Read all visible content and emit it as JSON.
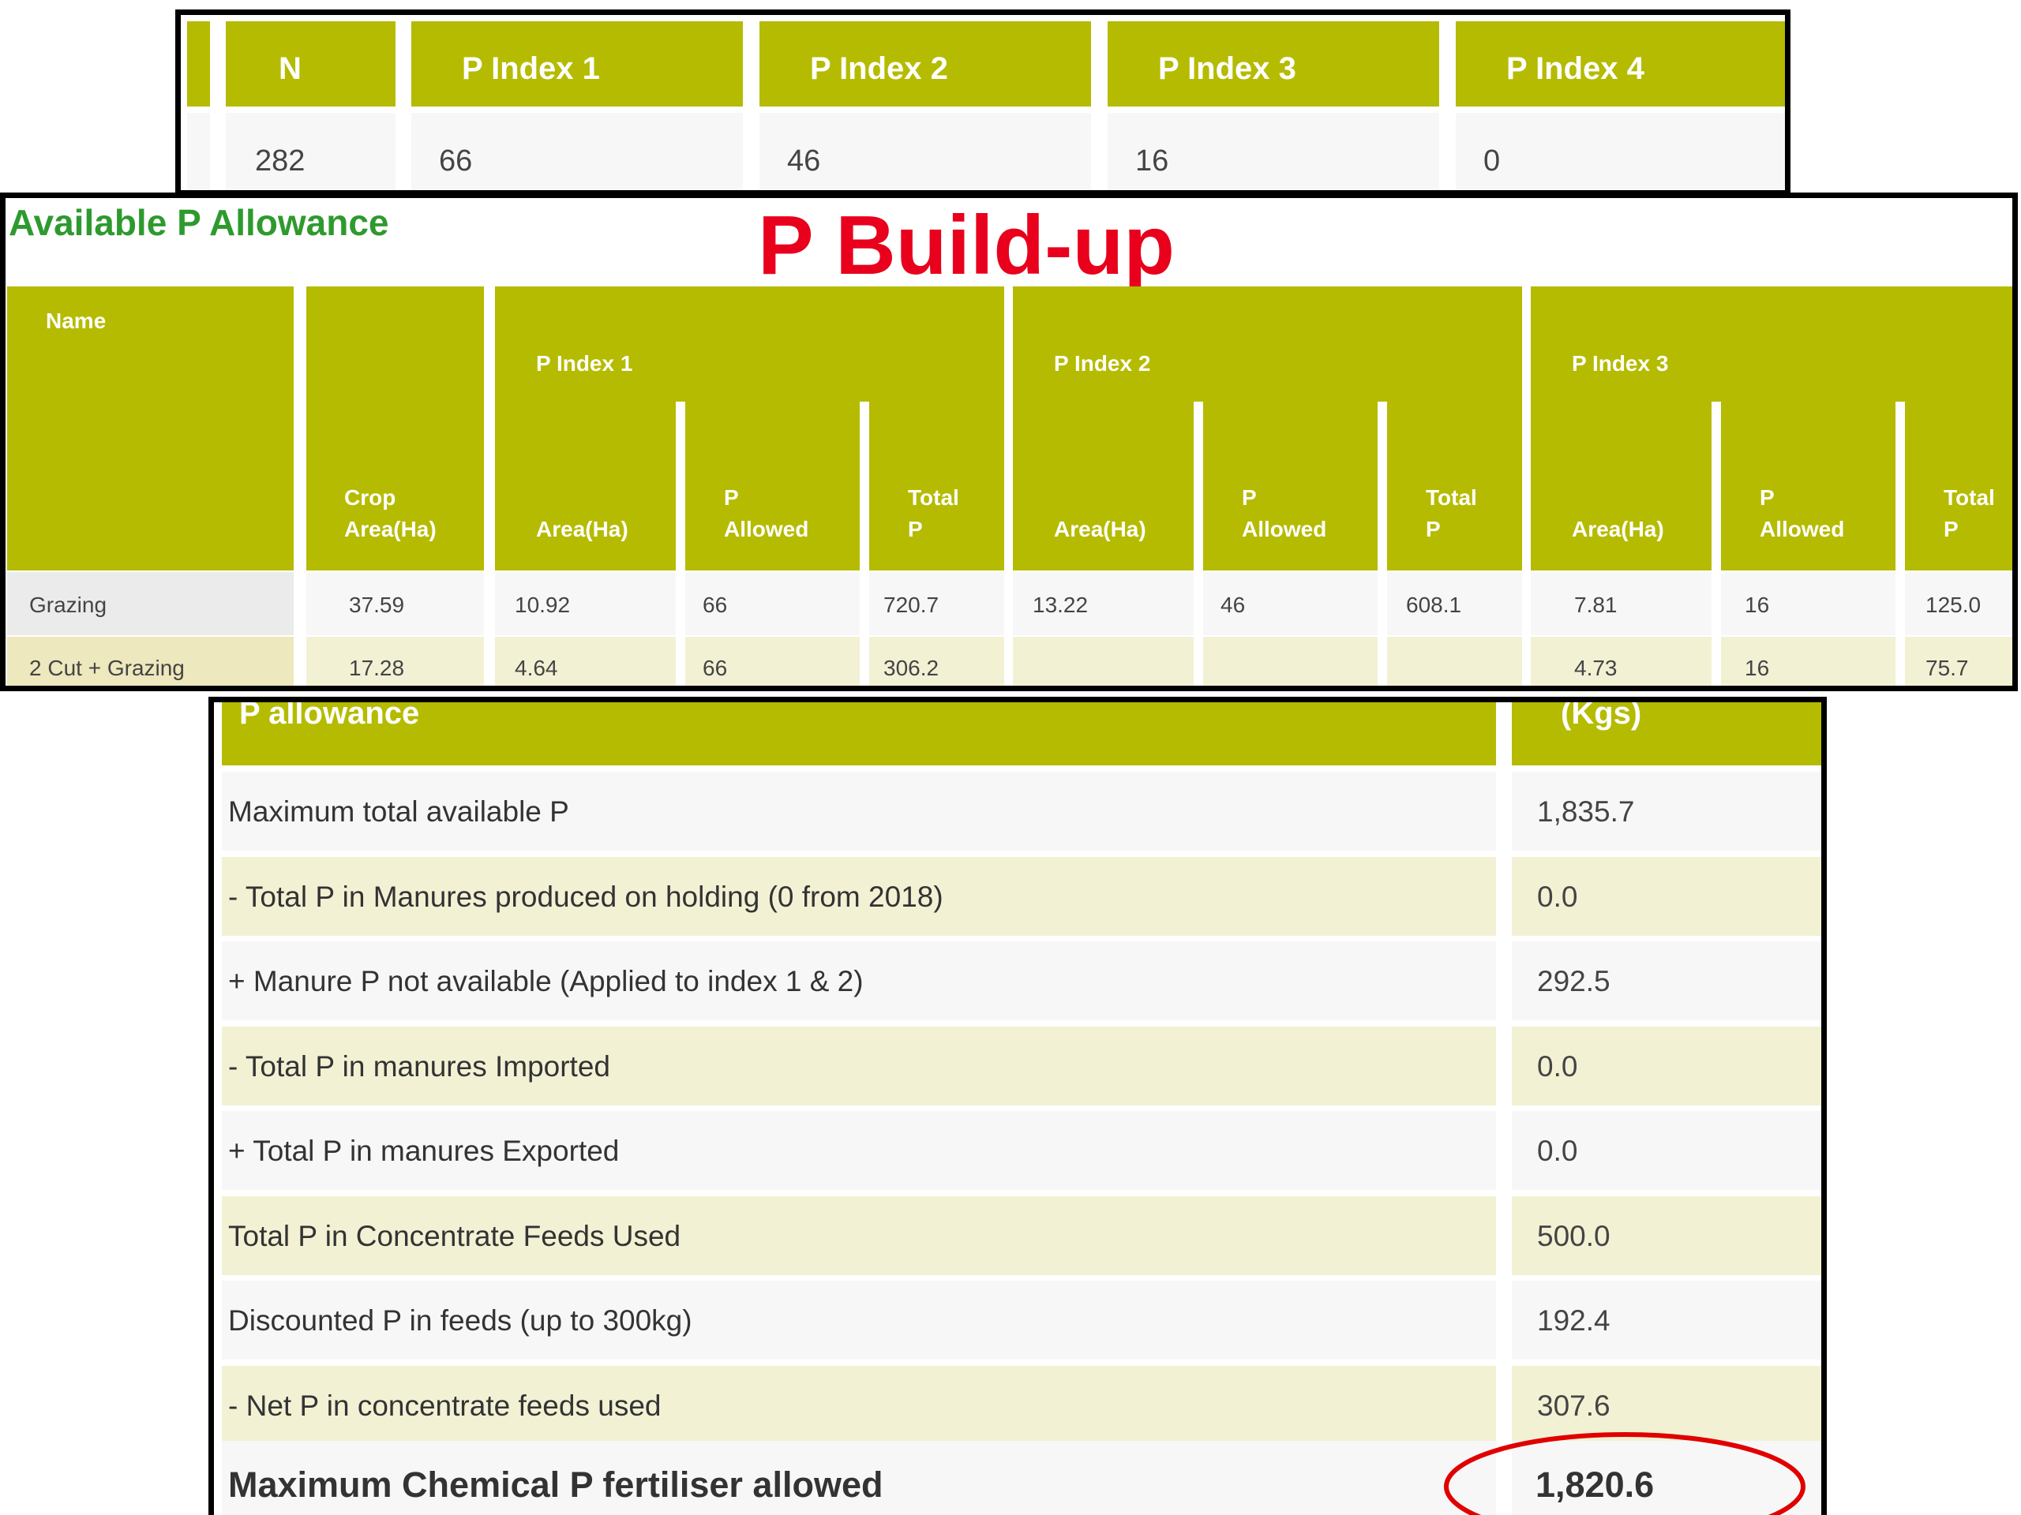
{
  "index_table": {
    "headers": [
      "N",
      "P Index 1",
      "P Index 2",
      "P Index 3",
      "P Index 4"
    ],
    "values": [
      "282",
      "66",
      "46",
      "16",
      "0"
    ]
  },
  "allowance_table": {
    "section_title": "Available P Allowance",
    "overlay_title": "P Build-up",
    "col_name": "Name",
    "col_crop_area_1": "Crop",
    "col_crop_area_2": "Area(Ha)",
    "groups": [
      "P Index 1",
      "P Index 2",
      "P Index 3"
    ],
    "sub_area": "Area(Ha)",
    "sub_allowed_1": "P",
    "sub_allowed_2": "Allowed",
    "sub_total_1": "Total",
    "sub_total_2": "P",
    "rows": [
      {
        "name": "Grazing",
        "crop_area": "37.59",
        "i1_area": "10.92",
        "i1_allowed": "66",
        "i1_total": "720.7",
        "i2_area": "13.22",
        "i2_allowed": "46",
        "i2_total": "608.1",
        "i3_area": "7.81",
        "i3_allowed": "16",
        "i3_total": "125.0"
      },
      {
        "name": "2 Cut + Grazing",
        "crop_area": "17.28",
        "i1_area": "4.64",
        "i1_allowed": "66",
        "i1_total": "306.2",
        "i2_area": "",
        "i2_allowed": "",
        "i2_total": "",
        "i3_area": "4.73",
        "i3_allowed": "16",
        "i3_total": "75.7"
      }
    ]
  },
  "summary_table": {
    "header_label": "P allowance",
    "header_unit": "(Kgs)",
    "rows": [
      {
        "label": "Maximum total available P",
        "value": "1,835.7"
      },
      {
        "label": "- Total P in Manures produced on holding (0 from 2018)",
        "value": "0.0"
      },
      {
        "label": "+ Manure P not available (Applied to index 1 & 2)",
        "value": "292.5"
      },
      {
        "label": "- Total P in manures Imported",
        "value": "0.0"
      },
      {
        "label": "+ Total P in manures Exported",
        "value": "0.0"
      },
      {
        "label": "Total P in Concentrate Feeds Used",
        "value": "500.0"
      },
      {
        "label": "Discounted P in feeds (up to 300kg)",
        "value": "192.4"
      },
      {
        "label": "- Net P in concentrate feeds used",
        "value": "307.6"
      }
    ],
    "final_label": "Maximum Chemical P fertiliser allowed",
    "final_value": "1,820.6"
  },
  "colors": {
    "header_olive": "#b5bb00",
    "row_alt_yellow": "#f3f1d4",
    "title_green": "#2e9a2e",
    "overlay_red": "#e8001c"
  }
}
